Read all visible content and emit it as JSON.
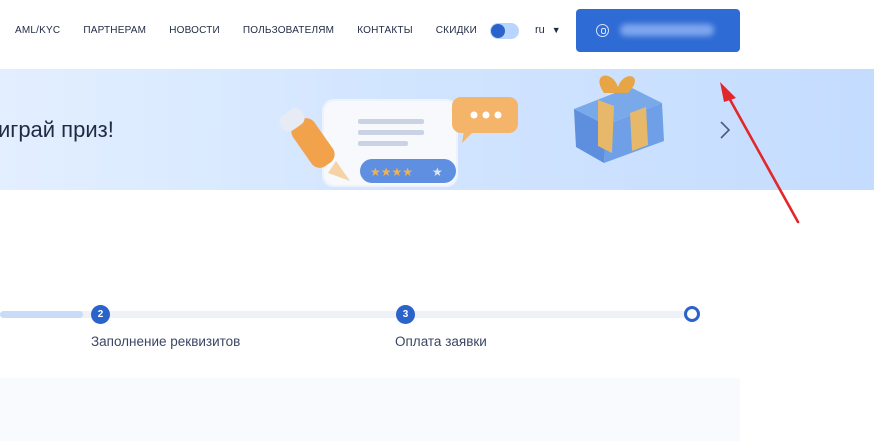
{
  "nav": {
    "items": [
      "AML/KYC",
      "ПАРТНЕРАМ",
      "НОВОСТИ",
      "ПОЛЬЗОВАТЕЛЯМ",
      "КОНТАКТЫ",
      "СКИДКИ"
    ]
  },
  "theme_toggle": {
    "state": "on"
  },
  "language": {
    "selected": "ru",
    "arrow": "▼"
  },
  "login_button": {
    "icon": "user-lock-icon",
    "label_blurred": true
  },
  "banner": {
    "title": "играй приз!",
    "next_arrow": "chevron-right-icon",
    "illustration": [
      "pencil",
      "review-card",
      "chat-bubble",
      "gift-box"
    ],
    "stars": 5
  },
  "stepper": {
    "progress": 0.12,
    "steps": [
      {
        "number": "2",
        "label": "Заполнение реквизитов"
      },
      {
        "number": "3",
        "label": "Оплата заявки"
      },
      {
        "number": "",
        "label": ""
      }
    ]
  },
  "annotation": {
    "color": "#e3262a",
    "type": "arrow"
  },
  "colors": {
    "accent": "#2f6bd4",
    "banner_bg": "#d2e5ff",
    "text": "#1f2a44"
  }
}
